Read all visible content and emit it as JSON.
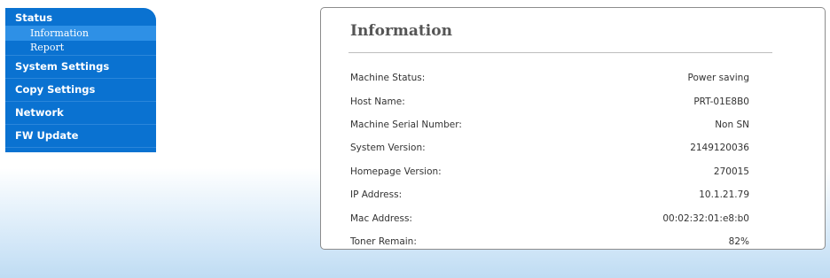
{
  "sidebar": {
    "status": "Status",
    "status_items": [
      {
        "label": "Information"
      },
      {
        "label": "Report"
      }
    ],
    "system_settings": "System Settings",
    "copy_settings": "Copy Settings",
    "network": "Network",
    "fw_update": "FW Update"
  },
  "panel": {
    "title": "Information",
    "rows": [
      {
        "label": "Machine Status:",
        "value": "Power saving"
      },
      {
        "label": "Host Name:",
        "value": "PRT-01E8B0"
      },
      {
        "label": "Machine Serial Number:",
        "value": "Non SN"
      },
      {
        "label": "System Version:",
        "value": "2149120036"
      },
      {
        "label": "Homepage Version:",
        "value": "270015"
      },
      {
        "label": "IP Address:",
        "value": "10.1.21.79"
      },
      {
        "label": "Mac Address:",
        "value": "00:02:32:01:e8:b0"
      },
      {
        "label": "Toner Remain:",
        "value": "82%"
      }
    ]
  },
  "colors": {
    "sidebar_bg": "#0a72d1",
    "sidebar_active": "#2e90e6",
    "bottom_gradient": "#bfdcf3"
  }
}
